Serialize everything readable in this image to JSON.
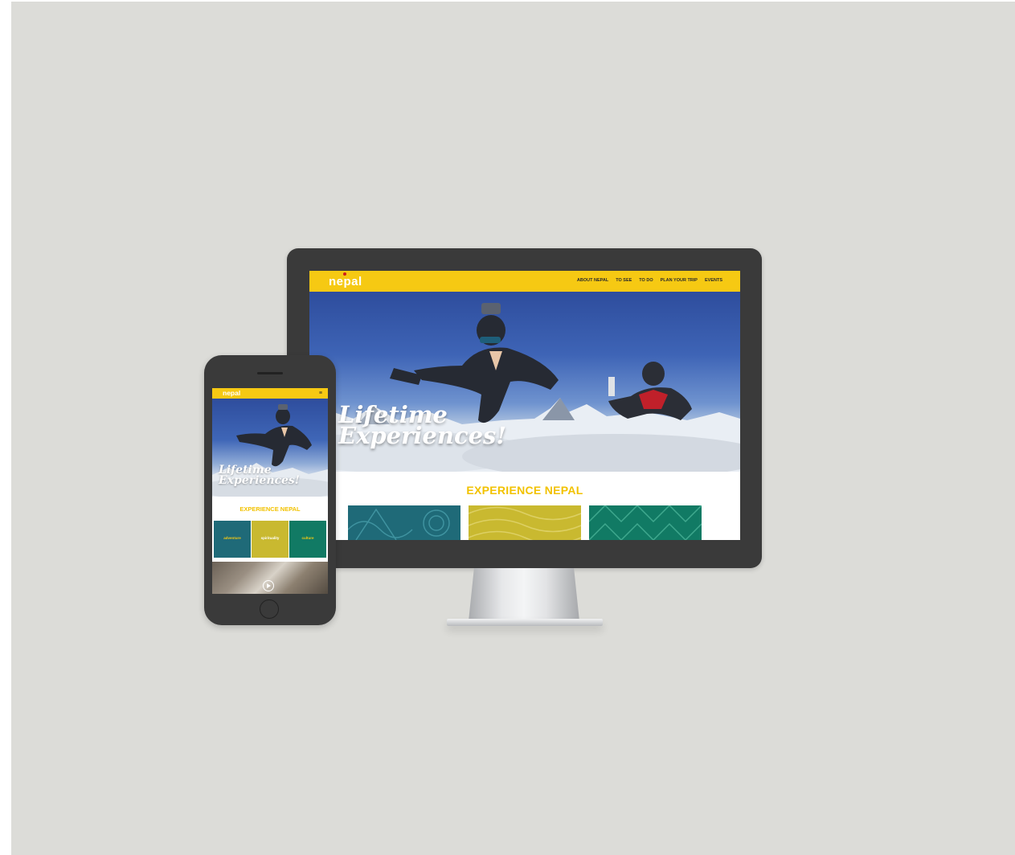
{
  "desktop": {
    "logo": "nepal",
    "nav_items": [
      "ABOUT NEPAL",
      "TO SEE",
      "TO DO",
      "PLAN YOUR TRIP",
      "EVENTS"
    ],
    "hero_line1": "Lifetime",
    "hero_line2": "Experiences!",
    "section_title": "EXPERIENCE NEPAL"
  },
  "mobile": {
    "logo": "nepal",
    "menu_icon": "hamburger-icon",
    "hero_line1": "Lifetime",
    "hero_line2": "Experiences!",
    "section_title": "EXPERIENCE NEPAL",
    "tiles": [
      "adventure",
      "spirituality",
      "culture"
    ]
  },
  "colors": {
    "brand_yellow": "#f6c913",
    "tile_teal": "#1f6a78",
    "tile_mustard": "#c9b930",
    "tile_green": "#117a64",
    "logo_dot_red": "#d01c1c"
  }
}
